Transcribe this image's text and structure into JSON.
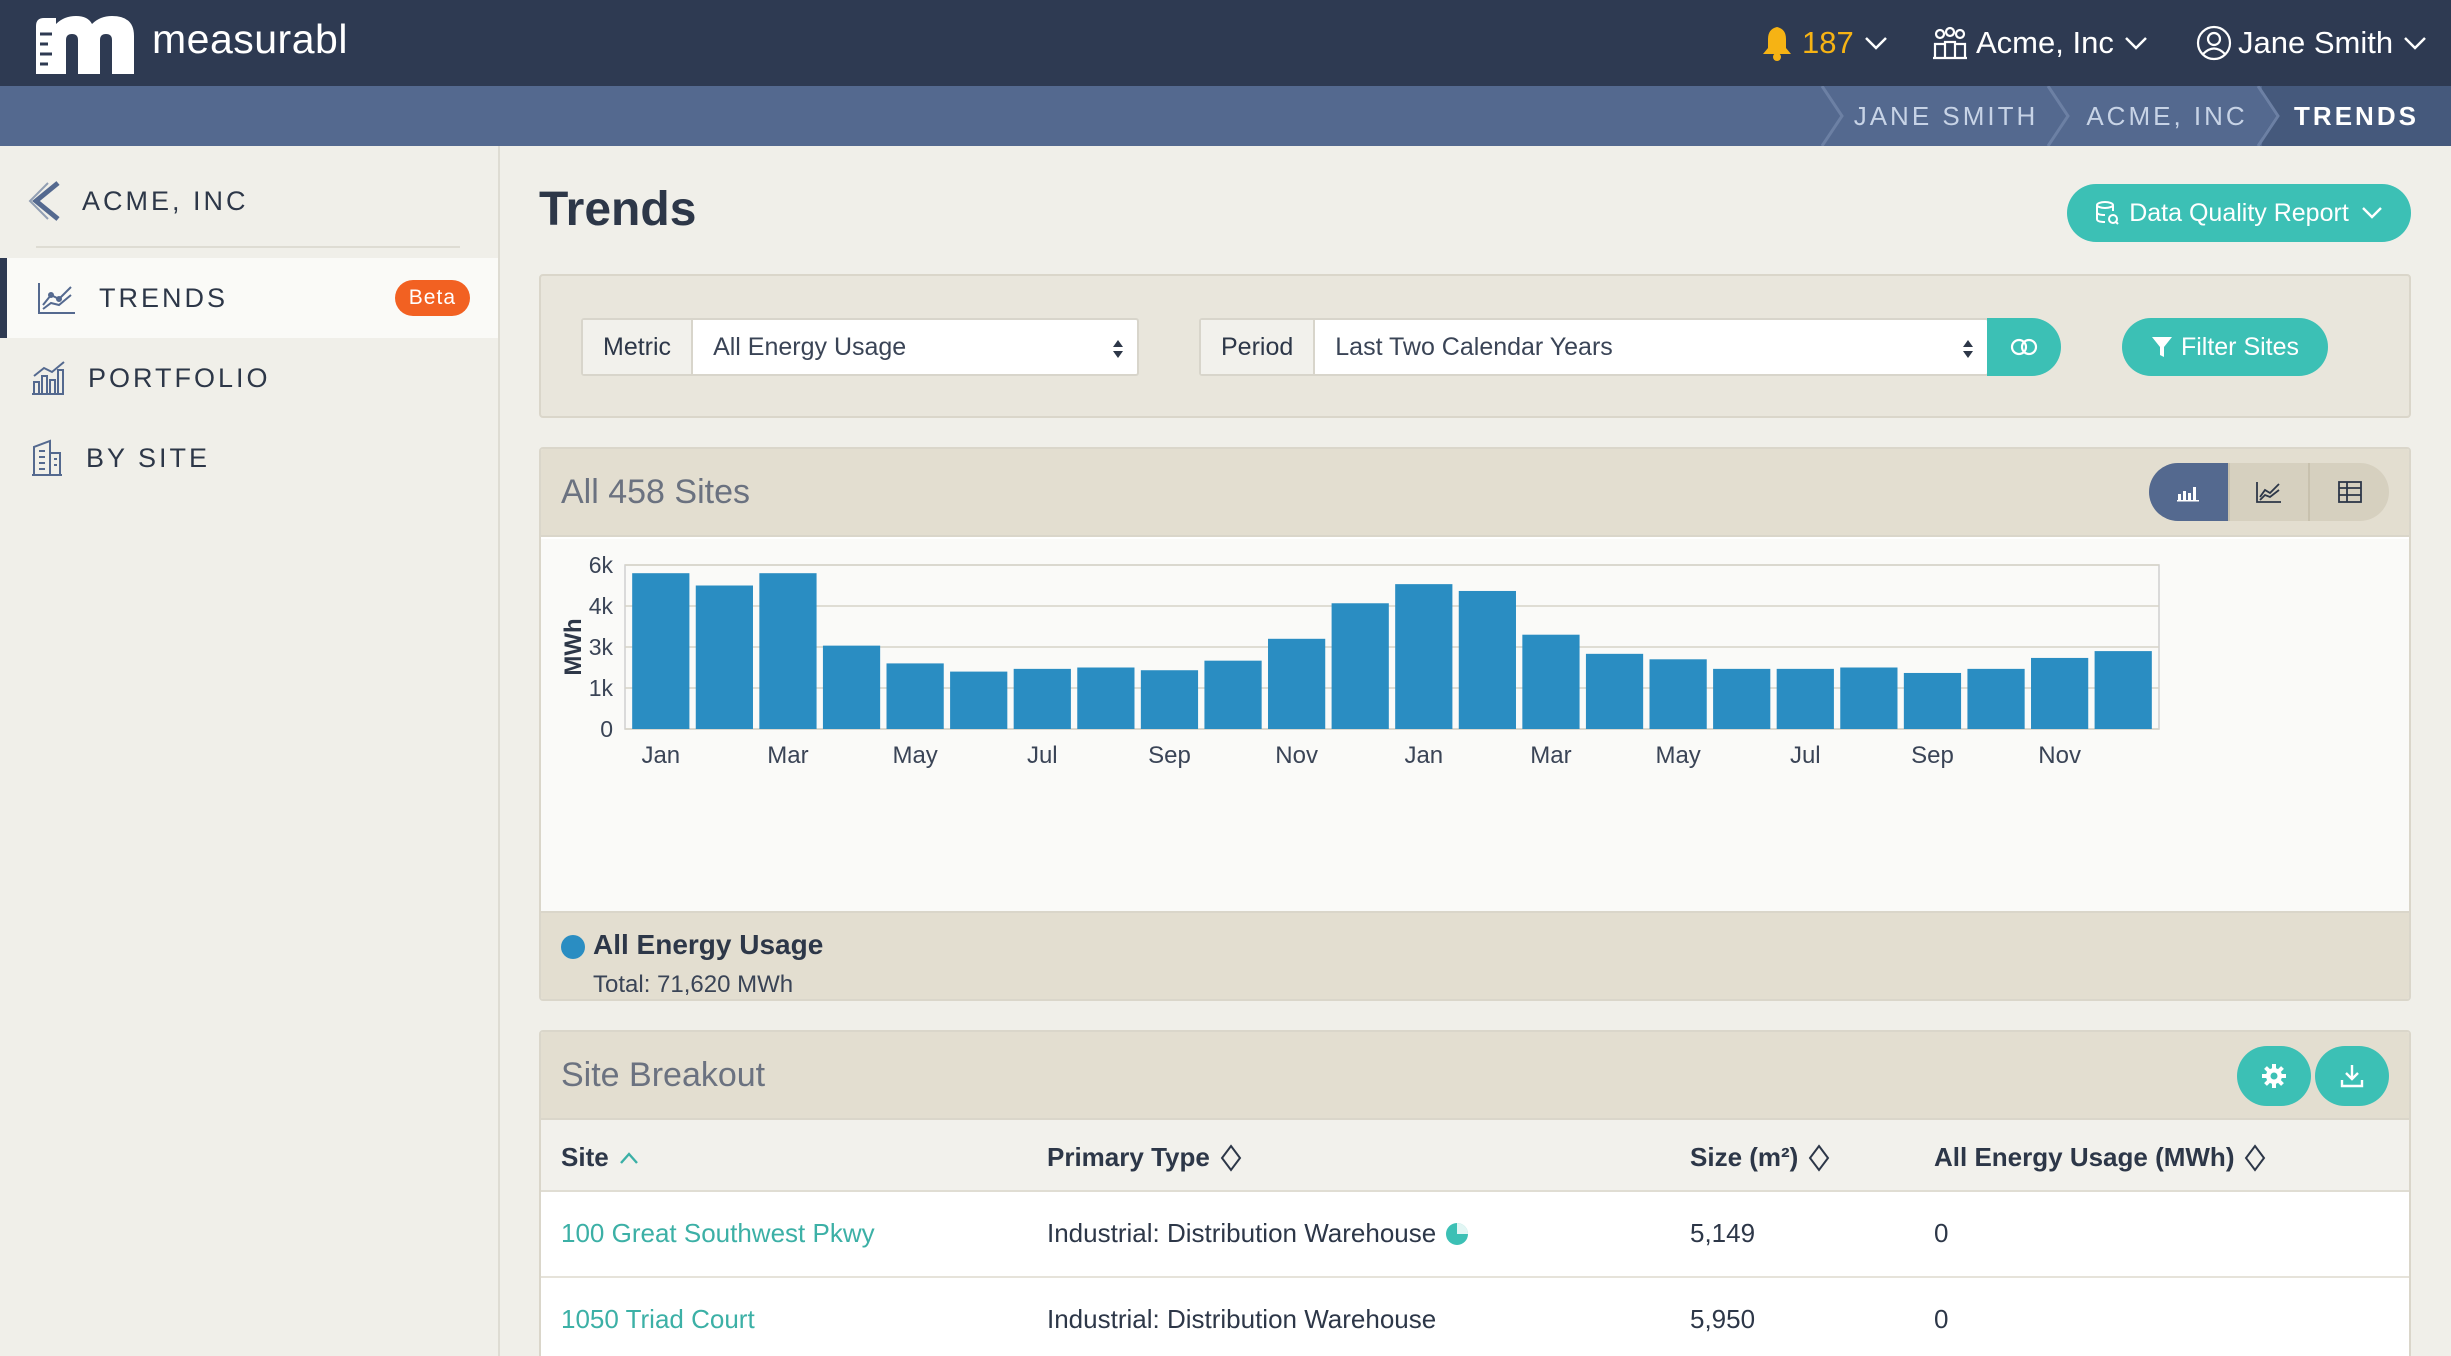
{
  "app": {
    "brand": "measurabl",
    "notifications_count": "187",
    "org_name": "Acme, Inc",
    "user_name": "Jane Smith",
    "colors": {
      "navy": "#2e3a52",
      "teal": "#3cc0b5",
      "bar": "#2a8dc2",
      "badge": "#f26122",
      "bell": "#f6b314"
    }
  },
  "breadcrumbs": [
    {
      "label": "JANE SMITH"
    },
    {
      "label": "ACME, INC"
    },
    {
      "label": "TRENDS"
    }
  ],
  "sidebar": {
    "back_label": "ACME, INC",
    "items": [
      {
        "label": "TRENDS",
        "icon": "line-chart-icon",
        "badge": "Beta",
        "active": true
      },
      {
        "label": "PORTFOLIO",
        "icon": "bar-chart-icon"
      },
      {
        "label": "BY SITE",
        "icon": "building-icon"
      }
    ]
  },
  "main": {
    "title": "Trends",
    "data_quality_label": "Data Quality Report",
    "filters": {
      "metric_label": "Metric",
      "metric_value": "All Energy Usage",
      "period_label": "Period",
      "period_value": "Last Two Calendar Years",
      "filter_sites_label": "Filter Sites"
    },
    "chart_card": {
      "title": "All 458 Sites",
      "legend_name": "All Energy Usage",
      "legend_total": "Total: 71,620 MWh"
    },
    "breakout": {
      "title": "Site Breakout",
      "columns": [
        "Site",
        "Primary Type",
        "Size (m²)",
        "All Energy Usage (MWh)"
      ],
      "rows": [
        {
          "site": "100 Great Southwest Pkwy",
          "type": "Industrial: Distribution Warehouse",
          "size": "5,149",
          "usage": "0",
          "type_icon": "pie-chart-icon"
        },
        {
          "site": "1050 Triad Court",
          "type": "Industrial: Distribution Warehouse",
          "size": "5,950",
          "usage": "0"
        }
      ]
    }
  },
  "chart_data": {
    "type": "bar",
    "title": "",
    "xlabel": "",
    "ylabel": "MWh",
    "ylim": [
      0,
      6
    ],
    "y_ticks": [
      "0",
      "1k",
      "3k",
      "4k",
      "6k"
    ],
    "x_tick_labels": [
      "Jan",
      "Mar",
      "May",
      "Jul",
      "Sep",
      "Nov",
      "Jan",
      "Mar",
      "May",
      "Jul",
      "Sep",
      "Nov"
    ],
    "categories": [
      "Jan",
      "Feb",
      "Mar",
      "Apr",
      "May",
      "Jun",
      "Jul",
      "Aug",
      "Sep",
      "Oct",
      "Nov",
      "Dec",
      "Jan",
      "Feb",
      "Mar",
      "Apr",
      "May",
      "Jun",
      "Jul",
      "Aug",
      "Sep",
      "Oct",
      "Nov",
      "Dec"
    ],
    "series": [
      {
        "name": "All Energy Usage",
        "values": [
          5.7,
          5.25,
          5.7,
          3.05,
          2.4,
          2.1,
          2.2,
          2.25,
          2.15,
          2.5,
          3.3,
          4.6,
          5.3,
          5.05,
          3.45,
          2.75,
          2.55,
          2.2,
          2.2,
          2.25,
          2.05,
          2.2,
          2.6,
          2.85
        ],
        "color": "#2a8dc2"
      }
    ],
    "grid": true,
    "legend": "bottom-left"
  }
}
